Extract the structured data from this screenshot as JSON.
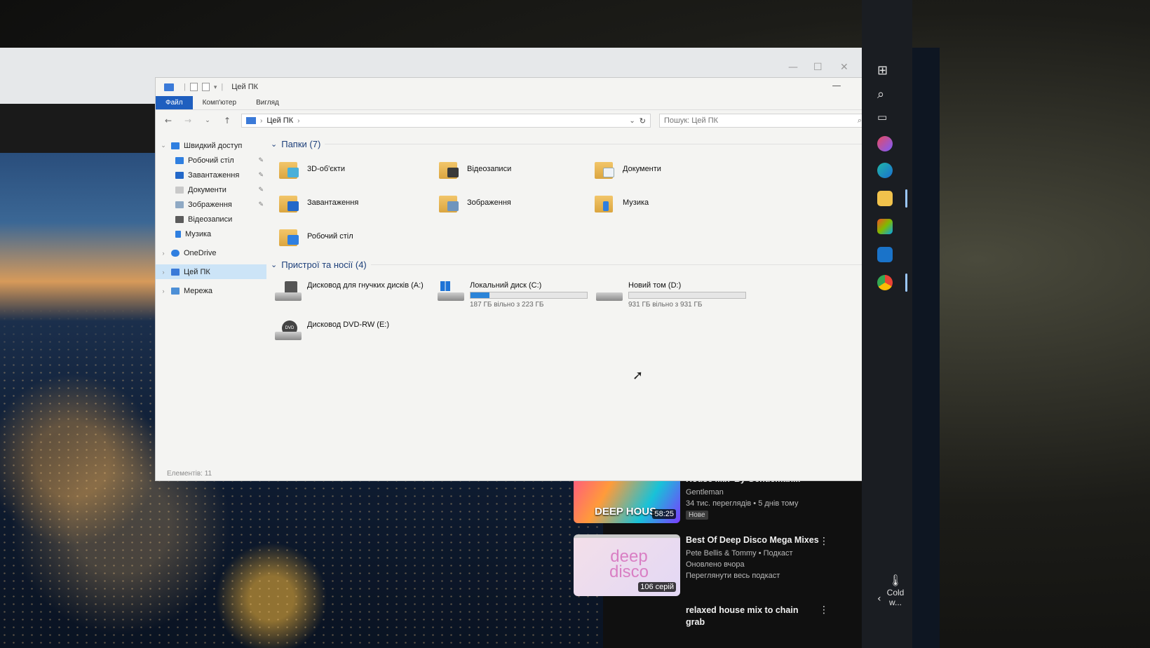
{
  "youtube": {
    "channel": "gentleman",
    "recommendations": [
      {
        "title": "Deep Classics | Elegant Deep House Mix' By Gentleman...",
        "channel": "Gentleman",
        "meta": "34 тис. переглядів • 5 днів тому",
        "badge": "Нове",
        "thumb_text": "DEEP HOUS",
        "duration": "58:25"
      },
      {
        "title": "Best Of Deep Disco Mega Mixes",
        "channel": "Pete Bellis & Tommy • Подкаст",
        "meta": "Оновлено вчора",
        "extra": "Переглянути весь подкаст",
        "thumb_text": "deep disco",
        "episodes": "106 серій"
      },
      {
        "title": "relaxed house mix to chain grab"
      }
    ]
  },
  "explorer": {
    "title": "Цей ПК",
    "ribbon_tabs": [
      "Файл",
      "Комп'ютер",
      "Вигляд"
    ],
    "address": "Цей ПК",
    "search_placeholder": "Пошук: Цей ПК",
    "sidebar": {
      "quick_access": "Швидкий доступ",
      "quick_items": [
        "Робочий стіл",
        "Завантаження",
        "Документи",
        "Зображення",
        "Відеозаписи",
        "Музика"
      ],
      "onedrive": "OneDrive",
      "this_pc": "Цей ПК",
      "network": "Мережа"
    },
    "folders_header": "Папки (7)",
    "folders": [
      "3D-об'єкти",
      "Відеозаписи",
      "Документи",
      "Завантаження",
      "Зображення",
      "Музика",
      "Робочий стіл"
    ],
    "devices_header": "Пристрої та носії (4)",
    "drives": [
      {
        "name": "Дисковод для гнучких дисків (A:)"
      },
      {
        "name": "Локальний диск (C:)",
        "free": "187 ГБ вільно з 223 ГБ",
        "used_fraction": 0.16
      },
      {
        "name": "Новий том (D:)",
        "free": "931 ГБ вільно з 931 ГБ",
        "used_fraction": 0.0
      },
      {
        "name": "Дисковод DVD-RW (E:)"
      }
    ],
    "status": "Елементів: 11"
  },
  "taskbar": {
    "weather": "Cold w..."
  },
  "colors": {
    "accent": "#1f5fbf",
    "drive_bar": "#2b84d8",
    "folder": "#f2c66a"
  }
}
